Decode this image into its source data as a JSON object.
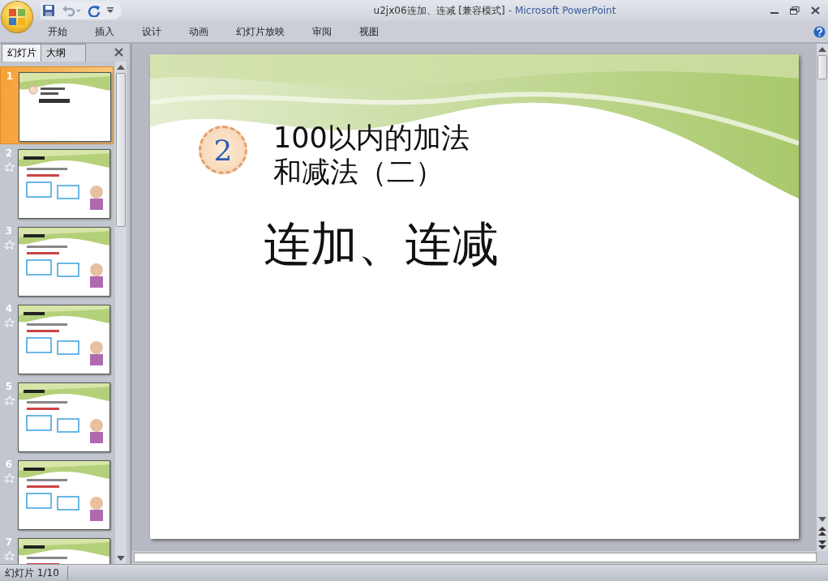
{
  "window": {
    "title": "u2jx06连加、连减 [兼容模式]",
    "app": "- Microsoft PowerPoint"
  },
  "ribbon_tabs": [
    {
      "label": "开始",
      "selected": false
    },
    {
      "label": "插入",
      "selected": false
    },
    {
      "label": "设计",
      "selected": false
    },
    {
      "label": "动画",
      "selected": false
    },
    {
      "label": "幻灯片放映",
      "selected": false
    },
    {
      "label": "审阅",
      "selected": false
    },
    {
      "label": "视图",
      "selected": false
    }
  ],
  "pane_tabs": [
    {
      "label": "幻灯片",
      "selected": true
    },
    {
      "label": "大纲",
      "selected": false
    }
  ],
  "slides": [
    {
      "number": "1",
      "selected": true,
      "animated": false,
      "kind": "title"
    },
    {
      "number": "2",
      "selected": false,
      "animated": true,
      "kind": "content"
    },
    {
      "number": "3",
      "selected": false,
      "animated": true,
      "kind": "content"
    },
    {
      "number": "4",
      "selected": false,
      "animated": true,
      "kind": "content"
    },
    {
      "number": "5",
      "selected": false,
      "animated": true,
      "kind": "content"
    },
    {
      "number": "6",
      "selected": false,
      "animated": true,
      "kind": "content"
    },
    {
      "number": "7",
      "selected": false,
      "animated": true,
      "kind": "content"
    }
  ],
  "slide": {
    "badge": "2",
    "title_lines": [
      "100以内的加法",
      "和减法（二）"
    ],
    "subtitle": "连加、连减"
  },
  "status_bar": {
    "text": "幻灯片 1/10"
  }
}
